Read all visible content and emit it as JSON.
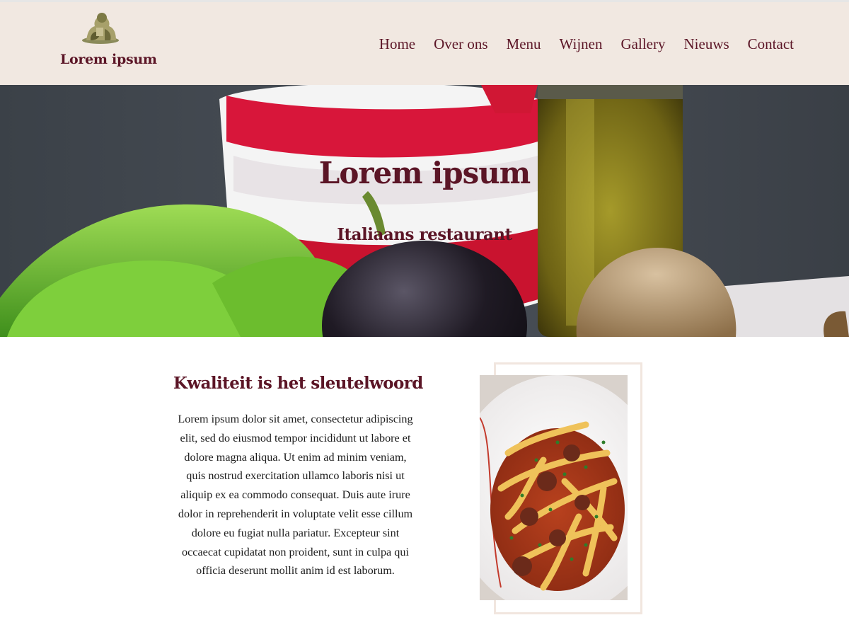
{
  "header": {
    "logo_text": "Lorem ipsum",
    "nav": [
      {
        "label": "Home"
      },
      {
        "label": "Over ons"
      },
      {
        "label": "Menu"
      },
      {
        "label": "Wijnen"
      },
      {
        "label": "Gallery"
      },
      {
        "label": "Nieuws"
      },
      {
        "label": "Contact"
      }
    ]
  },
  "hero": {
    "title": "Lorem ipsum",
    "subtitle": "Italiaans restaurant"
  },
  "intro": {
    "title": "Kwaliteit is het sleutelwoord",
    "body": "Lorem ipsum dolor sit amet, consectetur adipiscing elit, sed do eiusmod tempor incididunt ut labore et dolore magna aliqua. Ut enim ad minim veniam, quis nostrud exercitation ullamco laboris nisi ut aliquip ex ea commodo consequat. Duis aute irure dolor in reprehenderit in voluptate velit esse cillum dolore eu fugiat nulla pariatur. Excepteur sint occaecat cupidatat non proident, sunt in culpa qui officia deserunt mollit anim id est laborum."
  },
  "colors": {
    "brand": "#5b1526",
    "header_bg": "#f1e8e1",
    "frame": "#f1e6df"
  }
}
